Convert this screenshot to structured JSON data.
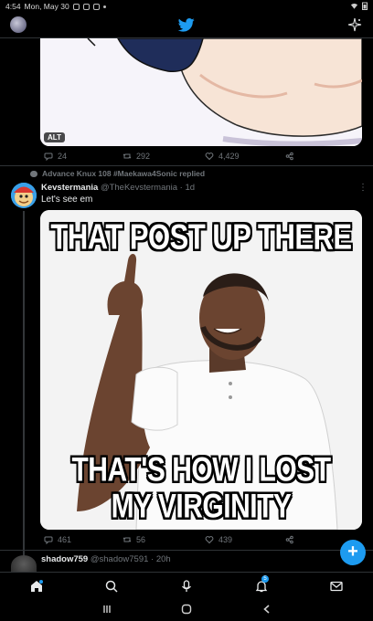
{
  "status_bar": {
    "time": "4:54",
    "date": "Mon, May 30"
  },
  "tweet1": {
    "alt_badge": "ALT",
    "replies": "24",
    "retweets": "292",
    "likes": "4,429"
  },
  "tweet2": {
    "context": "Advance Knux 108 #Maekawa4Sonic replied",
    "display_name": "Kevstermania",
    "handle_time": "@TheKevstermania · 1d",
    "text": "Let's see em",
    "meme_top": "THAT POST UP THERE",
    "meme_bottom_1": "THAT'S HOW I LOST",
    "meme_bottom_2": "MY VIRGINITY",
    "replies": "461",
    "retweets": "56",
    "likes": "439"
  },
  "tweet3": {
    "display_name": "shadow759",
    "handle_time": "@shadow7591 · 20h"
  },
  "compose_button": "+",
  "nav": {
    "notifications_badge": "5"
  },
  "colors": {
    "accent": "#1d9bf0",
    "background": "#000000",
    "muted": "#71767b"
  },
  "icons": [
    "twitter-logo-icon",
    "sparkle-icon",
    "reply-icon",
    "retweet-icon",
    "like-icon",
    "share-icon",
    "home-icon",
    "search-icon",
    "spaces-icon",
    "bell-icon",
    "mail-icon"
  ]
}
